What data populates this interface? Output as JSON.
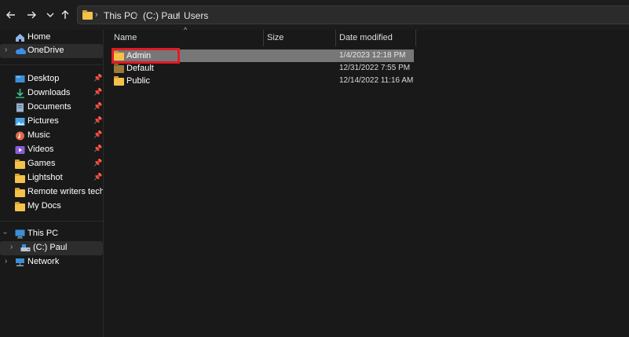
{
  "addressbar": {
    "crumbs": [
      "This PC",
      "(C:) Paul",
      "Users"
    ]
  },
  "sidebar": {
    "items": [
      {
        "label": "Home",
        "icon": "home-icon"
      },
      {
        "label": "OneDrive",
        "icon": "cloud-icon"
      },
      {
        "label": "Desktop",
        "icon": "desktop-icon"
      },
      {
        "label": "Downloads",
        "icon": "download-icon"
      },
      {
        "label": "Documents",
        "icon": "document-icon"
      },
      {
        "label": "Pictures",
        "icon": "picture-icon"
      },
      {
        "label": "Music",
        "icon": "music-icon"
      },
      {
        "label": "Videos",
        "icon": "video-icon"
      },
      {
        "label": "Games",
        "icon": "folder-icon"
      },
      {
        "label": "Lightshot",
        "icon": "folder-icon"
      },
      {
        "label": "Remote writers tech",
        "icon": "folder-icon"
      },
      {
        "label": "My Docs",
        "icon": "folder-icon"
      },
      {
        "label": "This PC",
        "icon": "pc-icon"
      },
      {
        "label": "(C:) Paul",
        "icon": "drive-icon"
      },
      {
        "label": "Network",
        "icon": "network-icon"
      }
    ]
  },
  "columns": {
    "name": "Name",
    "size": "Size",
    "date_modified": "Date modified"
  },
  "files": [
    {
      "name": "Admin",
      "date": "1/4/2023 12:18 PM"
    },
    {
      "name": "Default",
      "date": "12/31/2022 7:55 PM"
    },
    {
      "name": "Public",
      "date": "12/14/2022 11:16 AM"
    }
  ],
  "colors": {
    "background": "#191919",
    "selection": "#777777",
    "highlight_box": "#e01b24",
    "folder": "#f3c24a"
  }
}
